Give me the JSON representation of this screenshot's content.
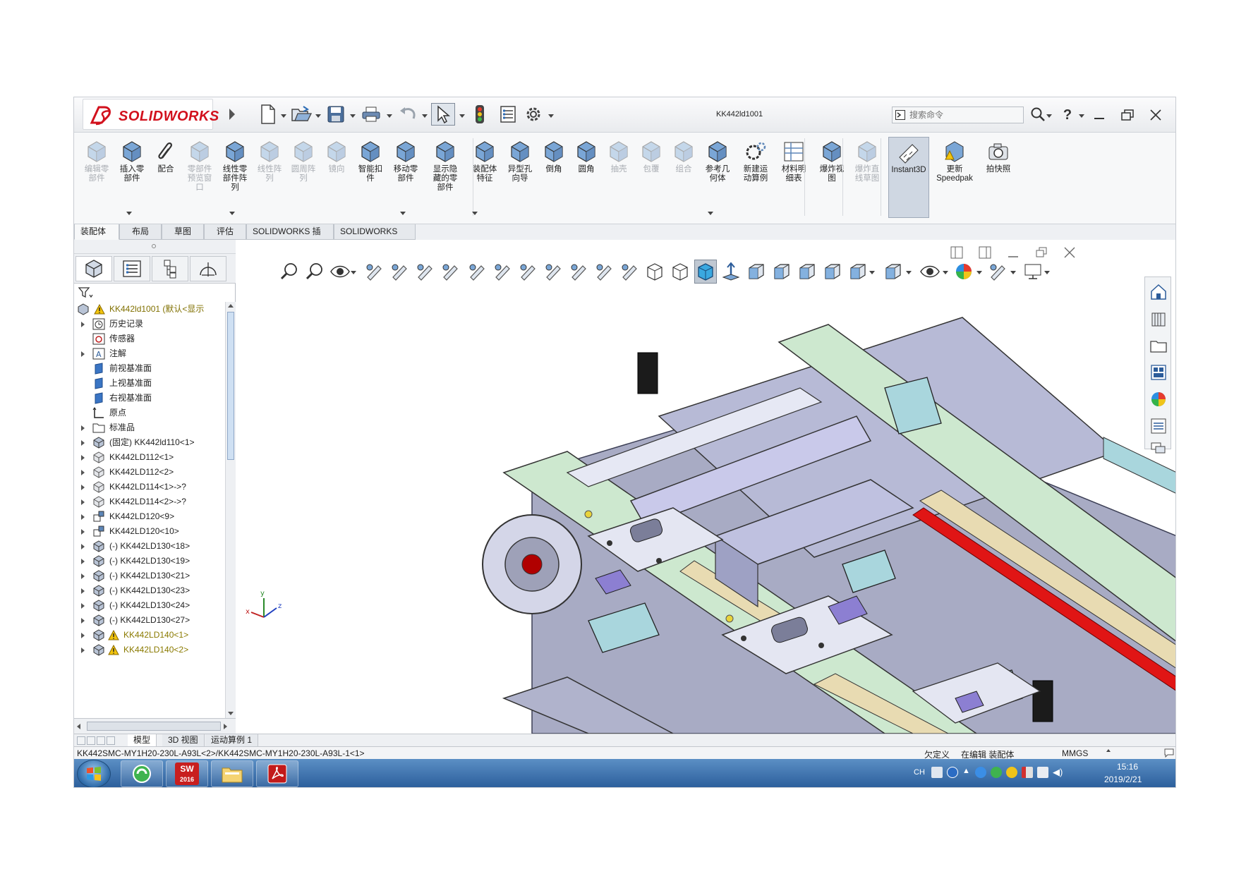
{
  "app": {
    "brand": "SOLIDWORKS",
    "document_title": "KK442ld1001",
    "search_placeholder": "搜索命令",
    "help_label": "?"
  },
  "ribbon": {
    "buttons": [
      {
        "label": "编辑零\n部件",
        "icon": "edit-component-icon",
        "disabled": true
      },
      {
        "label": "插入零\n部件",
        "icon": "insert-component-icon",
        "disabled": false
      },
      {
        "label": "配合",
        "icon": "mate-paperclip-icon",
        "disabled": false
      },
      {
        "label": "零部件\n预览窗\n口",
        "icon": "component-preview-icon",
        "disabled": true
      },
      {
        "label": "线性零\n部件阵\n列",
        "icon": "linear-pattern-icon",
        "disabled": false
      },
      {
        "label": "线性阵\n列",
        "icon": "linear-array-icon",
        "disabled": true
      },
      {
        "label": "圆周阵\n列",
        "icon": "circular-array-icon",
        "disabled": true
      },
      {
        "label": "镜向",
        "icon": "mirror-icon",
        "disabled": true
      },
      {
        "label": "智能扣\n件",
        "icon": "smart-fastener-icon",
        "disabled": false
      },
      {
        "label": "移动零\n部件",
        "icon": "move-component-icon",
        "disabled": false
      },
      {
        "label": "显示隐\n藏的零\n部件",
        "icon": "show-hidden-icon",
        "disabled": false
      },
      {
        "label": "装配体\n特征",
        "icon": "assembly-feature-icon",
        "disabled": false
      },
      {
        "label": "异型孔\n向导",
        "icon": "hole-wizard-icon",
        "disabled": false
      },
      {
        "label": "倒角",
        "icon": "chamfer-icon",
        "disabled": false
      },
      {
        "label": "圆角",
        "icon": "fillet-icon",
        "disabled": false
      },
      {
        "label": "抽壳",
        "icon": "shell-icon",
        "disabled": true
      },
      {
        "label": "包覆",
        "icon": "wrap-icon",
        "disabled": true
      },
      {
        "label": "组合",
        "icon": "combine-icon",
        "disabled": true
      },
      {
        "label": "参考几\n何体",
        "icon": "reference-geometry-icon",
        "disabled": false
      },
      {
        "label": "新建运\n动算例",
        "icon": "new-motion-study-icon",
        "disabled": false
      },
      {
        "label": "材料明\n细表",
        "icon": "bill-of-materials-icon",
        "disabled": false
      },
      {
        "label": "爆炸视\n图",
        "icon": "exploded-view-icon",
        "disabled": false
      },
      {
        "label": "爆炸直\n线草图",
        "icon": "explode-line-sketch-icon",
        "disabled": true
      },
      {
        "label": "Instant3D",
        "icon": "instant3d-icon",
        "disabled": false,
        "selected": true
      },
      {
        "label": "更新\nSpeedpak",
        "icon": "speedpak-warning-icon",
        "disabled": false
      },
      {
        "label": "拍快照",
        "icon": "snapshot-camera-icon",
        "disabled": false
      }
    ]
  },
  "command_tabs": [
    "装配体",
    "布局",
    "草图",
    "评估",
    "SOLIDWORKS 插件",
    "SOLIDWORKS MBD"
  ],
  "tree": {
    "root": "KK442ld1001 (默认<显示",
    "items": [
      {
        "label": "历史记录",
        "icon": "history-icon",
        "expandable": true,
        "warn": false
      },
      {
        "label": "传感器",
        "icon": "sensor-icon",
        "expandable": false,
        "warn": false
      },
      {
        "label": "注解",
        "icon": "annotation-icon",
        "expandable": true,
        "warn": false
      },
      {
        "label": "前视基准面",
        "icon": "plane-icon",
        "expandable": false,
        "warn": false
      },
      {
        "label": "上视基准面",
        "icon": "plane-icon",
        "expandable": false,
        "warn": false
      },
      {
        "label": "右视基准面",
        "icon": "plane-icon",
        "expandable": false,
        "warn": false
      },
      {
        "label": "原点",
        "icon": "origin-icon",
        "expandable": false,
        "warn": false
      },
      {
        "label": "标准品",
        "icon": "folder-icon",
        "expandable": true,
        "warn": false
      },
      {
        "label": "(固定) KK442ld110<1>",
        "icon": "assembly-icon",
        "expandable": true,
        "warn": false
      },
      {
        "label": "KK442LD112<1>",
        "icon": "assembly-gray-icon",
        "expandable": true,
        "warn": false
      },
      {
        "label": "KK442LD112<2>",
        "icon": "assembly-gray-icon",
        "expandable": true,
        "warn": false
      },
      {
        "label": "KK442LD114<1>->?",
        "icon": "assembly-gray-icon",
        "expandable": true,
        "warn": false
      },
      {
        "label": "KK442LD114<2>->?",
        "icon": "assembly-gray-icon",
        "expandable": true,
        "warn": false
      },
      {
        "label": "KK442LD120<9>",
        "icon": "subassembly-icon",
        "expandable": true,
        "warn": false
      },
      {
        "label": "KK442LD120<10>",
        "icon": "subassembly-icon",
        "expandable": true,
        "warn": false
      },
      {
        "label": "(-) KK442LD130<18>",
        "icon": "assembly-icon",
        "expandable": true,
        "warn": false
      },
      {
        "label": "(-) KK442LD130<19>",
        "icon": "assembly-icon",
        "expandable": true,
        "warn": false
      },
      {
        "label": "(-) KK442LD130<21>",
        "icon": "assembly-icon",
        "expandable": true,
        "warn": false
      },
      {
        "label": "(-) KK442LD130<23>",
        "icon": "assembly-icon",
        "expandable": true,
        "warn": false
      },
      {
        "label": "(-) KK442LD130<24>",
        "icon": "assembly-icon",
        "expandable": true,
        "warn": false
      },
      {
        "label": "(-) KK442LD130<27>",
        "icon": "assembly-icon",
        "expandable": true,
        "warn": false
      },
      {
        "label": "KK442LD140<1>",
        "icon": "assembly-icon",
        "expandable": true,
        "warn": true
      },
      {
        "label": "KK442LD140<2>",
        "icon": "assembly-icon",
        "expandable": true,
        "warn": true
      }
    ]
  },
  "model_tabs": [
    "模型",
    "3D 视图",
    "运动算例 1"
  ],
  "status": {
    "path": "KK442SMC-MY1H20-230L-A93L<2>/KK442SMC-MY1H20-230L-A93L-1<1>",
    "state1": "欠定义",
    "state2": "在编辑 装配体",
    "units": "MMGS"
  },
  "taskbar": {
    "lang": "CH",
    "time": "15:16",
    "date": "2019/2/21",
    "sw_badge": "2016"
  },
  "colors": {
    "brand_red": "#d2111d",
    "part_blue": "#b9bce0",
    "rail_green": "#cde8cf",
    "cylinder_teal": "#a9d6dd",
    "red_strip": "#e01515"
  }
}
